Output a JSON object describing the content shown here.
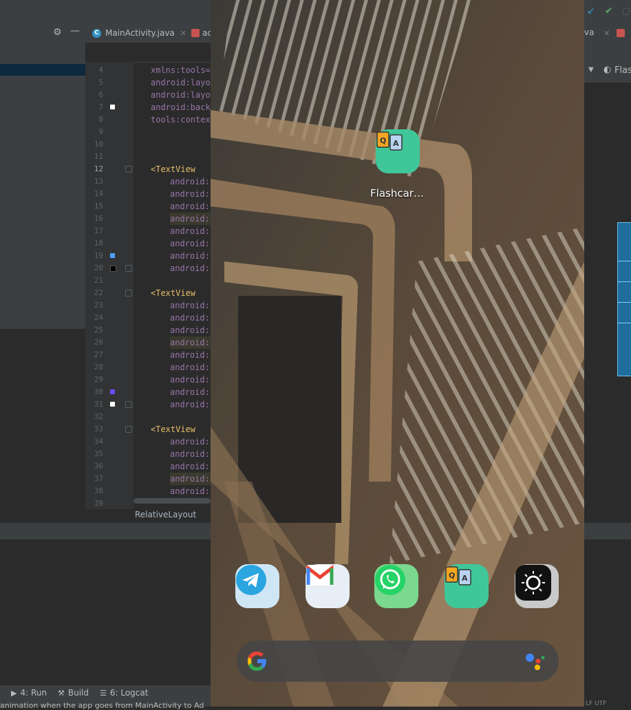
{
  "ide": {
    "editor_tabs": [
      {
        "label": "MainActivity.java"
      },
      {
        "label": "ac"
      }
    ],
    "right_tabs": {
      "partial_label": "va",
      "preview_title": "Flas"
    },
    "line_numbers": [
      "4",
      "5",
      "6",
      "7",
      "8",
      "9",
      "10",
      "11",
      "12",
      "13",
      "14",
      "15",
      "16",
      "17",
      "18",
      "19",
      "20",
      "21",
      "22",
      "23",
      "24",
      "25",
      "26",
      "27",
      "28",
      "29",
      "30",
      "31",
      "32",
      "33",
      "34",
      "35",
      "36",
      "37",
      "38",
      "39"
    ],
    "code_lines": {
      "l4": "xmlns:tools=\"",
      "l5": "android:layou",
      "l6": "android:layou",
      "l7": "android:backg",
      "l8": "tools:contex",
      "textview": "<TextView",
      "android_prefix": "android:"
    },
    "breadcrumb": "RelativeLayout",
    "bottom_toolbar": {
      "run": "4: Run",
      "build": "Build",
      "logcat": "6: Logcat"
    },
    "status_text": "animation when the app goes from MainActivity to Ad",
    "right_status": "LF  UTF"
  },
  "emulator": {
    "home_app_label": "Flashcar…",
    "dock_apps": [
      {
        "name": "Telegram",
        "color": "#2aa5e0"
      },
      {
        "name": "Gmail",
        "color": "#ffffff"
      },
      {
        "name": "WhatsApp",
        "color": "#25d366"
      },
      {
        "name": "Flashcards",
        "color": "#3fc79a"
      },
      {
        "name": "Camera",
        "color": "#111111"
      }
    ],
    "search_bar": {
      "logo": "G"
    }
  },
  "colors": {
    "ide_bg": "#2b2b2b",
    "ide_panel": "#3c3f41",
    "xml_tag": "#e8bf6a",
    "xml_attr": "#9876aa"
  }
}
